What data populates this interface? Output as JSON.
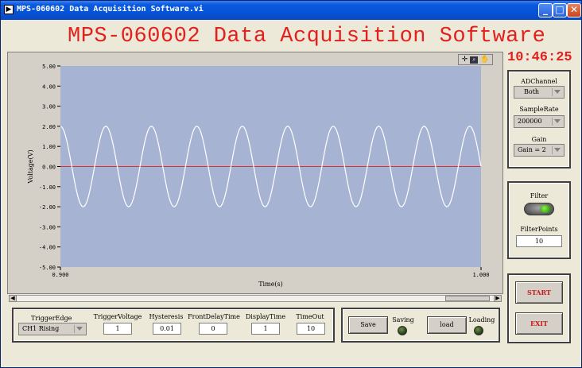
{
  "window": {
    "icon_glyph": "▶",
    "title": "MPS-060602 Data Acquisition Software.vi",
    "buttons": [
      "minimize-icon",
      "maximize-icon",
      "close-icon"
    ],
    "min_glyph": "_",
    "max_glyph": "□",
    "close_glyph": "✕"
  },
  "header": {
    "main_title": "MPS-060602 Data Acquisition Software",
    "clock": "10:46:25",
    "title_color": "#e4201c"
  },
  "graph": {
    "toolbar": [
      "cursor-move-icon",
      "zoom-icon",
      "pan-hand-icon"
    ],
    "plot_bg": "#a7b3d3",
    "trace_color": "#ffffff",
    "zero_line_color": "#e03030"
  },
  "chart_data": {
    "type": "line",
    "xlabel": "Time(s)",
    "ylabel": "Voltage(V)",
    "xlim": [
      0.9,
      1.0
    ],
    "ylim": [
      -5.0,
      5.0
    ],
    "x_tick_labels": [
      "0.900",
      "1.000"
    ],
    "y_tick_labels": [
      "5.00",
      "4.00",
      "3.00",
      "2.00",
      "1.00",
      "0.00",
      "-1.00",
      "-2.00",
      "-3.00",
      "-4.00",
      "-5.00"
    ],
    "series": [
      {
        "amplitude": 2.0,
        "cycles": 9.25,
        "x_range": [
          0.9,
          1.0
        ]
      },
      {
        "values": [
          0.0
        ]
      }
    ]
  },
  "trigger_panel": {
    "trigger_edge": {
      "label": "TriggerEdge",
      "value": "CH1 Rising"
    },
    "trigger_voltage": {
      "label": "TriggerVoltage",
      "value": "1"
    },
    "hysteresis": {
      "label": "Hysteresis",
      "value": "0.01"
    },
    "front_delay_time": {
      "label": "FrontDelayTime",
      "value": "0"
    },
    "display_time": {
      "label": "DisplayTime",
      "value": "1"
    },
    "timeout": {
      "label": "TimeOut",
      "value": "10"
    }
  },
  "file_panel": {
    "save_label": "Save",
    "saving_label": "Saving",
    "load_label": "load",
    "loading_label": "Loading"
  },
  "acq_panel": {
    "ad_channel": {
      "label": "ADChannel",
      "value": "Both"
    },
    "sample_rate": {
      "label": "SampleRate",
      "value": "200000"
    },
    "gain": {
      "label": "Gain",
      "value": "Gain = 2"
    }
  },
  "filter_panel": {
    "filter_label": "Filter",
    "filter_points_label": "FilterPoints",
    "filter_points_value": "10"
  },
  "control_panel": {
    "start_label": "START",
    "exit_label": "EXIT"
  }
}
